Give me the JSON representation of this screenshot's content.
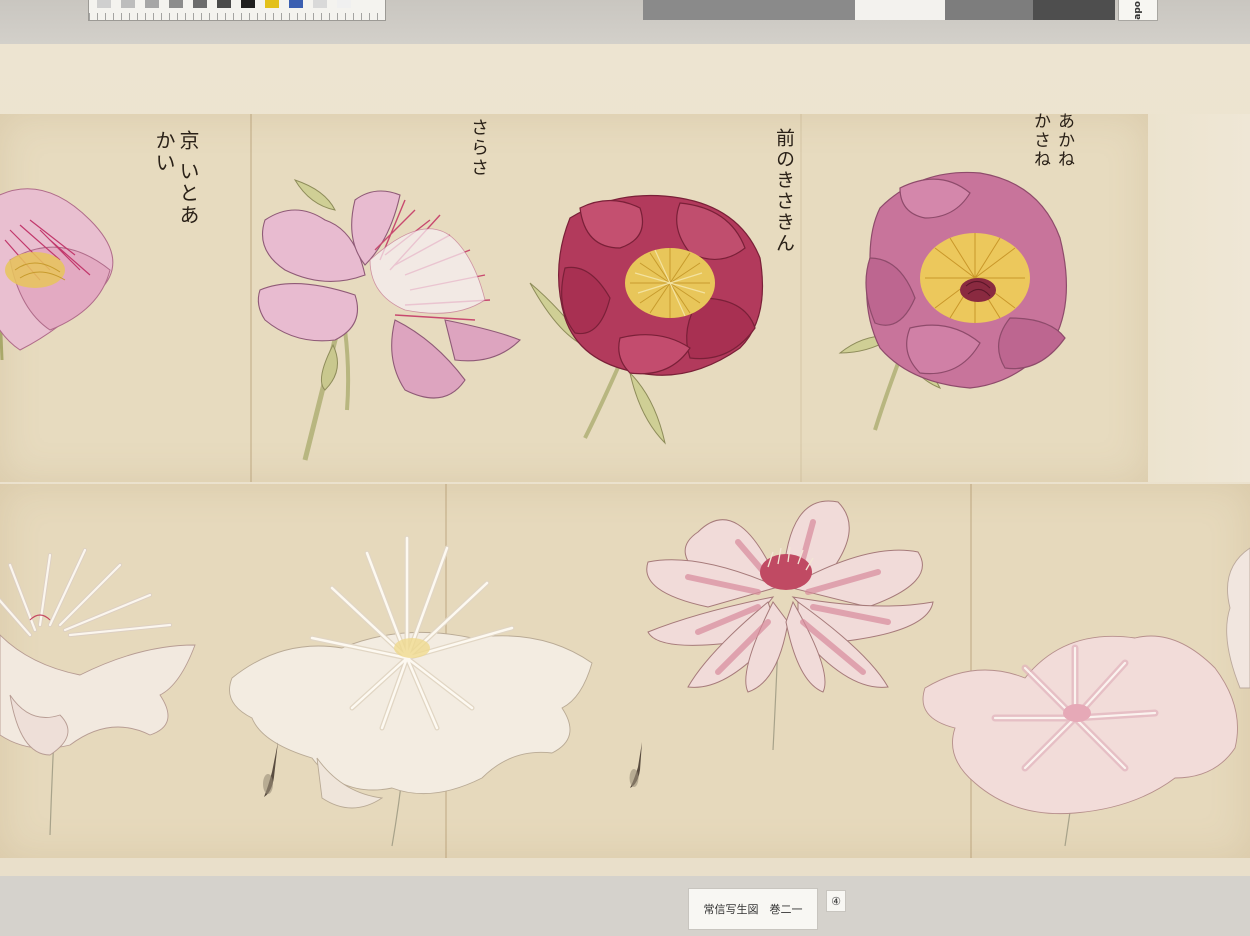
{
  "scan": {
    "color_card_swatches": [
      "#cfcfcf",
      "#bdbdbd",
      "#a6a6a6",
      "#8c8c8c",
      "#6c6c6c",
      "#4a4a4a",
      "#1f1f1f",
      "#e3c11b",
      "#3b5fb1",
      "#d9d9d9",
      "#f0f0f0"
    ],
    "gray_card_label": "apo",
    "gray_card_blocks": [
      "#8a8a8a",
      "#8a8a8a",
      "#f3f2ee",
      "#7d7d7d",
      "#4e4e4e"
    ]
  },
  "scroll": {
    "paper_color": "#e7dbbf",
    "captions": [
      {
        "id": "kyo-itoakai",
        "text": "京\nいとあかい"
      },
      {
        "id": "sarasa",
        "text": "さらさ"
      },
      {
        "id": "zen-no-kisaki",
        "text": "前のきさきん"
      },
      {
        "id": "akane-kasane",
        "text": "あかね\nかさね"
      }
    ],
    "flowers_top": [
      {
        "name": "peony-pink-partial",
        "color": "#c98aa6"
      },
      {
        "name": "peony-light-pink",
        "color": "#e3b3c9"
      },
      {
        "name": "peony-crimson",
        "color": "#b8405e"
      },
      {
        "name": "peony-rose",
        "color": "#c47097"
      }
    ],
    "flowers_bottom": [
      {
        "name": "peony-white-partial",
        "color": "#efe4d8"
      },
      {
        "name": "peony-white",
        "color": "#f1e9dc"
      },
      {
        "name": "peony-pink-streaked",
        "color": "#e8bcc6"
      },
      {
        "name": "peony-pale-pink",
        "color": "#eed3d4"
      }
    ]
  },
  "label": {
    "title": "常信写生図　巻二一",
    "number": "④"
  }
}
